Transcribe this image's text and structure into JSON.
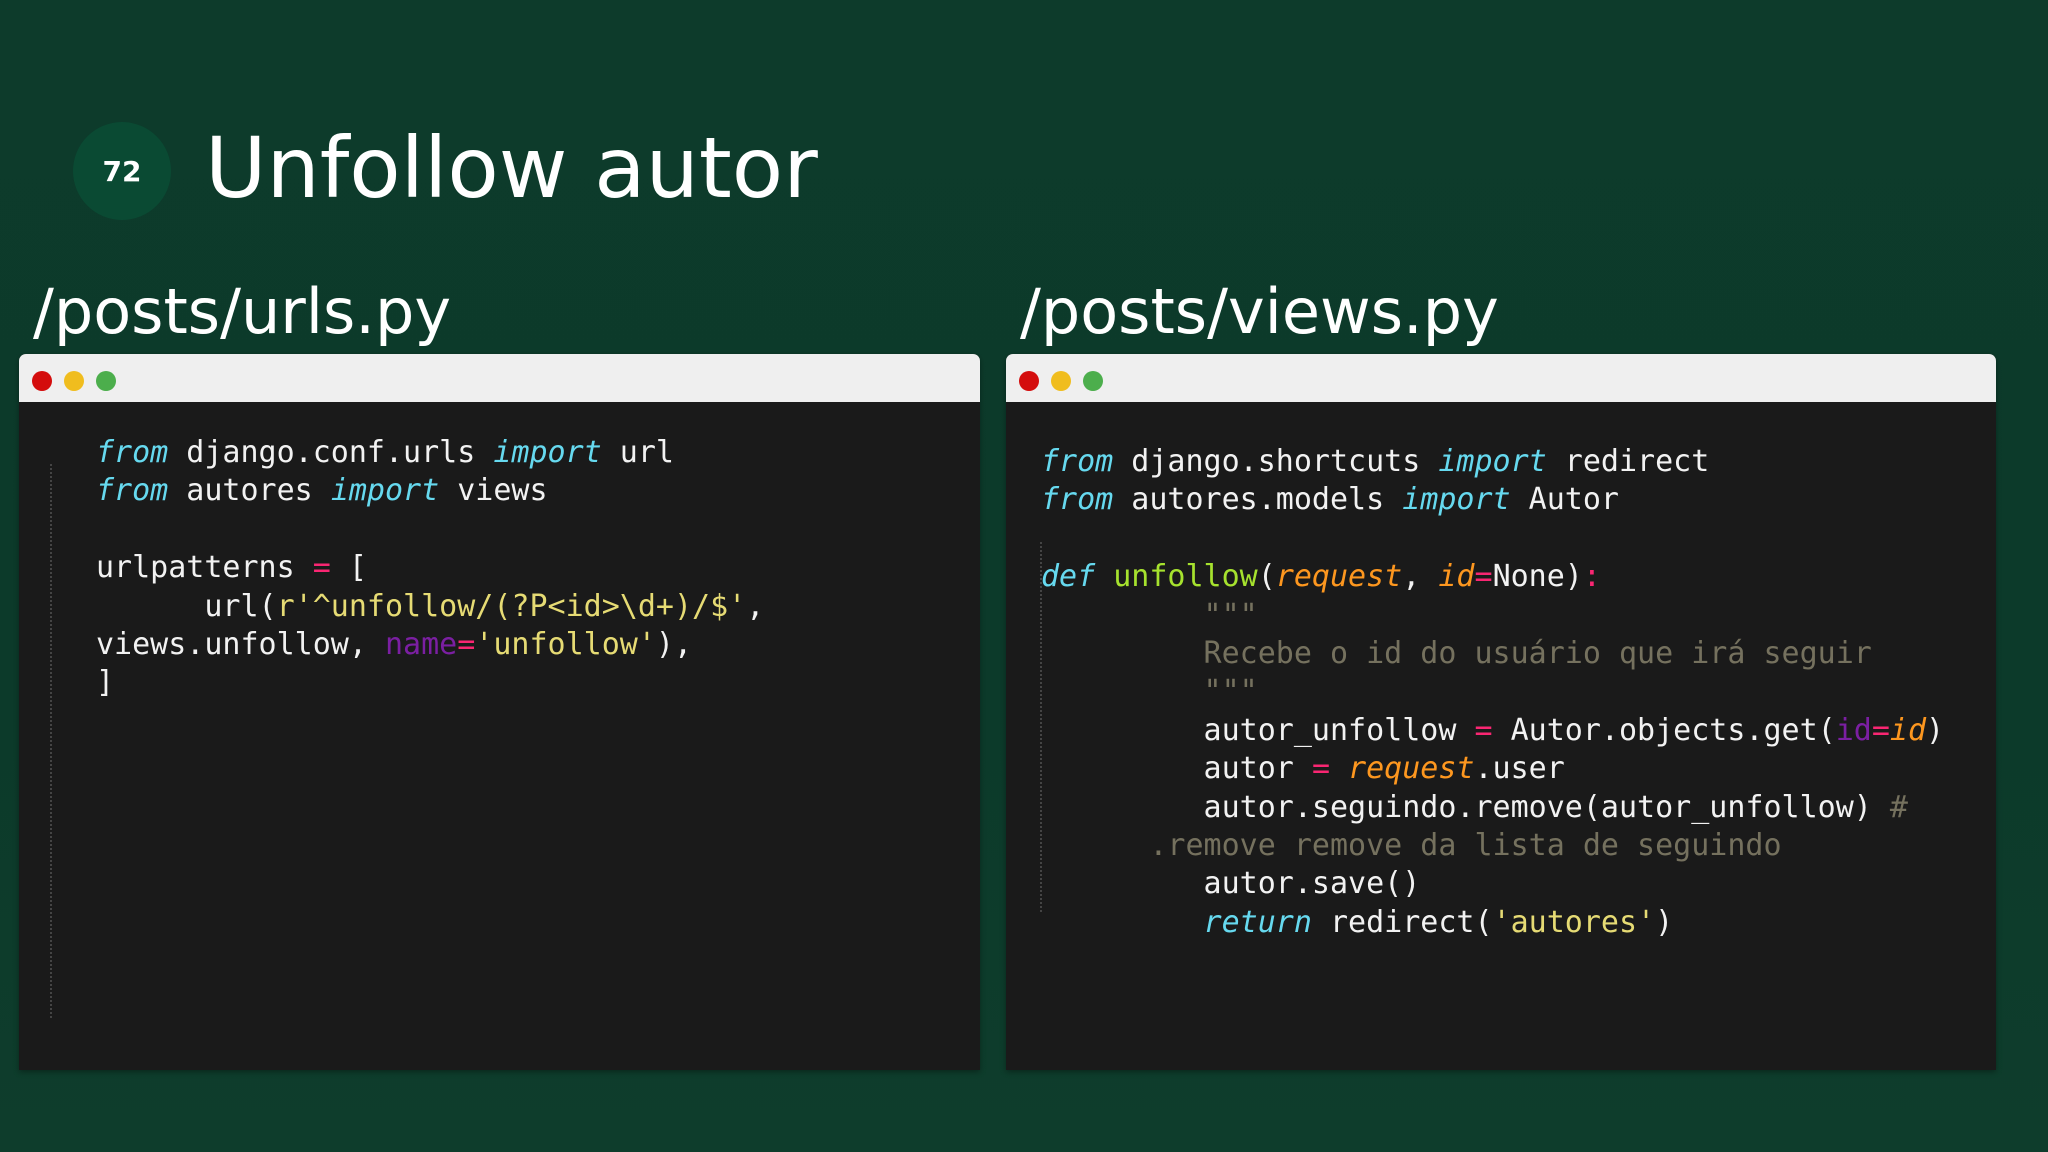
{
  "slide": {
    "number": "72",
    "title": "Unfollow autor"
  },
  "panels": [
    {
      "file_label": "/posts/urls.py",
      "lines": [
        [
          {
            "t": "from",
            "c": "kw"
          },
          {
            "t": " django.conf.urls ",
            "c": "white"
          },
          {
            "t": "import",
            "c": "kw"
          },
          {
            "t": " url",
            "c": "white"
          }
        ],
        [
          {
            "t": "from",
            "c": "kw"
          },
          {
            "t": " autores ",
            "c": "white"
          },
          {
            "t": "import",
            "c": "kw"
          },
          {
            "t": " views",
            "c": "white"
          }
        ],
        [],
        [
          {
            "t": "urlpatterns ",
            "c": "white"
          },
          {
            "t": "=",
            "c": "op"
          },
          {
            "t": " [",
            "c": "white"
          }
        ],
        [
          {
            "t": "      url(",
            "c": "white"
          },
          {
            "t": "r'^unfollow/(?P<id>\\d+)/$'",
            "c": "str"
          },
          {
            "t": ",",
            "c": "white"
          }
        ],
        [
          {
            "t": "views.unfollow, ",
            "c": "white"
          },
          {
            "t": "name",
            "c": "purple"
          },
          {
            "t": "=",
            "c": "op"
          },
          {
            "t": "'unfollow'",
            "c": "str"
          },
          {
            "t": "),",
            "c": "white"
          }
        ],
        [
          {
            "t": "]",
            "c": "white"
          }
        ]
      ]
    },
    {
      "file_label": "/posts/views.py",
      "lines": [
        [
          {
            "t": "from",
            "c": "kw"
          },
          {
            "t": " django.shortcuts ",
            "c": "white"
          },
          {
            "t": "import",
            "c": "kw"
          },
          {
            "t": " redirect",
            "c": "white"
          }
        ],
        [
          {
            "t": "from",
            "c": "kw"
          },
          {
            "t": " autores.models ",
            "c": "white"
          },
          {
            "t": "import",
            "c": "kw"
          },
          {
            "t": " Autor",
            "c": "white"
          }
        ],
        [],
        [
          {
            "t": "def",
            "c": "kw"
          },
          {
            "t": " ",
            "c": "white"
          },
          {
            "t": "unfollow",
            "c": "fn"
          },
          {
            "t": "(",
            "c": "white"
          },
          {
            "t": "request",
            "c": "param"
          },
          {
            "t": ", ",
            "c": "white"
          },
          {
            "t": "id",
            "c": "param"
          },
          {
            "t": "=",
            "c": "op"
          },
          {
            "t": "None)",
            "c": "white"
          },
          {
            "t": ":",
            "c": "op"
          }
        ],
        [
          {
            "t": "         \"\"\"",
            "c": "cmt"
          }
        ],
        [
          {
            "t": "         Recebe o id do usuário que irá seguir",
            "c": "cmt"
          }
        ],
        [
          {
            "t": "         \"\"\"",
            "c": "cmt"
          }
        ],
        [
          {
            "t": "         autor_unfollow ",
            "c": "white"
          },
          {
            "t": "=",
            "c": "op"
          },
          {
            "t": " Autor.objects.get(",
            "c": "white"
          },
          {
            "t": "id",
            "c": "purple"
          },
          {
            "t": "=",
            "c": "op"
          },
          {
            "t": "id",
            "c": "param"
          },
          {
            "t": ")",
            "c": "white"
          }
        ],
        [
          {
            "t": "         autor ",
            "c": "white"
          },
          {
            "t": "=",
            "c": "op"
          },
          {
            "t": " ",
            "c": "white"
          },
          {
            "t": "request",
            "c": "param"
          },
          {
            "t": ".user",
            "c": "white"
          }
        ],
        [
          {
            "t": "         autor.seguindo.remove(autor_unfollow) ",
            "c": "white"
          },
          {
            "t": "#",
            "c": "cmt"
          }
        ],
        [
          {
            "t": "      .remove remove da lista de seguindo",
            "c": "cmt"
          }
        ],
        [
          {
            "t": "         autor.save()",
            "c": "white"
          }
        ],
        [
          {
            "t": "         ",
            "c": "white"
          },
          {
            "t": "return",
            "c": "kw"
          },
          {
            "t": " redirect(",
            "c": "white"
          },
          {
            "t": "'autores'",
            "c": "str"
          },
          {
            "t": ")",
            "c": "white"
          }
        ]
      ]
    }
  ]
}
